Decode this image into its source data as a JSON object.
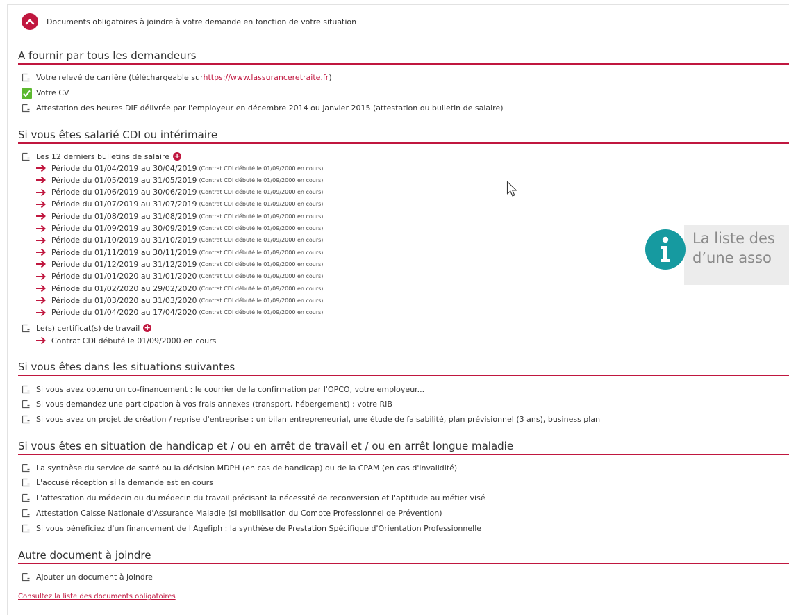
{
  "header": {
    "title": "Documents obligatoires à joindre à votre demande en fonction de votre situation"
  },
  "sections": {
    "all": {
      "title": "A fournir par tous les demandeurs",
      "items": [
        {
          "label": "Votre relevé de carrière (téléchargeable sur ",
          "link": "https://www.lassuranceretraite.fr",
          "suffix": ")",
          "checked": false
        },
        {
          "label": "Votre CV",
          "checked": true
        },
        {
          "label": "Attestation des heures DIF délivrée par l'employeur en décembre 2014 ou janvier 2015 (attestation ou bulletin de salaire)",
          "checked": false
        }
      ]
    },
    "salarie": {
      "title": "Si vous êtes salarié CDI ou intérimaire",
      "bulletins_label": "Les 12 derniers bulletins de salaire",
      "periods": [
        {
          "main": "Période du 01/04/2019 au 30/04/2019",
          "note": "(Contrat CDI débuté le 01/09/2000 en cours)"
        },
        {
          "main": "Période du 01/05/2019 au 31/05/2019",
          "note": "(Contrat CDI débuté le 01/09/2000 en cours)"
        },
        {
          "main": "Période du 01/06/2019 au 30/06/2019",
          "note": "(Contrat CDI débuté le 01/09/2000 en cours)"
        },
        {
          "main": "Période du 01/07/2019 au 31/07/2019",
          "note": "(Contrat CDI débuté le 01/09/2000 en cours)"
        },
        {
          "main": "Période du 01/08/2019 au 31/08/2019",
          "note": "(Contrat CDI débuté le 01/09/2000 en cours)"
        },
        {
          "main": "Période du 01/09/2019 au 30/09/2019",
          "note": "(Contrat CDI débuté le 01/09/2000 en cours)"
        },
        {
          "main": "Période du 01/10/2019 au 31/10/2019",
          "note": "(Contrat CDI débuté le 01/09/2000 en cours)"
        },
        {
          "main": "Période du 01/11/2019 au 30/11/2019",
          "note": "(Contrat CDI débuté le 01/09/2000 en cours)"
        },
        {
          "main": "Période du 01/12/2019 au 31/12/2019",
          "note": "(Contrat CDI débuté le 01/09/2000 en cours)"
        },
        {
          "main": "Période du 01/01/2020 au 31/01/2020",
          "note": "(Contrat CDI débuté le 01/09/2000 en cours)"
        },
        {
          "main": "Période du 01/02/2020 au 29/02/2020",
          "note": "(Contrat CDI débuté le 01/09/2000 en cours)"
        },
        {
          "main": "Période du 01/03/2020 au 31/03/2020",
          "note": "(Contrat CDI débuté le 01/09/2000 en cours)"
        },
        {
          "main": "Période du 01/04/2020 au 17/04/2020",
          "note": "(Contrat CDI débuté le 01/09/2000 en cours)"
        }
      ],
      "certificats_label": "Le(s) certificat(s) de travail",
      "contrat_label": "Contrat CDI débuté le 01/09/2000 en cours"
    },
    "situations": {
      "title": "Si vous êtes dans les situations suivantes",
      "items": [
        "Si vous avez obtenu un co-financement : le courrier de la confirmation par l'OPCO, votre employeur...",
        "Si vous demandez une participation à vos frais annexes (transport, hébergement) : votre RIB",
        "Si vous avez un projet de création / reprise d'entreprise : un bilan entrepreneurial, une étude de faisabilité, plan prévisionnel (3 ans), business plan"
      ]
    },
    "handicap": {
      "title": "Si vous êtes en situation de handicap et / ou en arrêt de travail et / ou en arrêt longue maladie",
      "items": [
        "La synthèse du service de santé ou la décision MDPH (en cas de handicap) ou de la CPAM (en cas d'invalidité)",
        "L'accusé réception si la demande est en cours",
        "L'attestation du médecin ou du médecin du travail précisant la nécessité de reconversion et l'aptitude au métier visé",
        "Attestation Caisse Nationale d'Assurance Maladie (si mobilisation du Compte Professionnel de Prévention)",
        "Si vous bénéficiez d'un financement de l'Agefiph : la synthèse de Prestation Spécifique d'Orientation Professionnelle"
      ]
    },
    "autre": {
      "title": "Autre document à joindre",
      "items": [
        "Ajouter un document à joindre"
      ]
    }
  },
  "info": {
    "line1": "La liste des",
    "line2": "d’une asso"
  },
  "footer": {
    "link_label": "Consultez la liste des documents obligatoires"
  },
  "colors": {
    "accent": "#c0173f",
    "check": "#5cb82f",
    "info": "#169aa0"
  }
}
